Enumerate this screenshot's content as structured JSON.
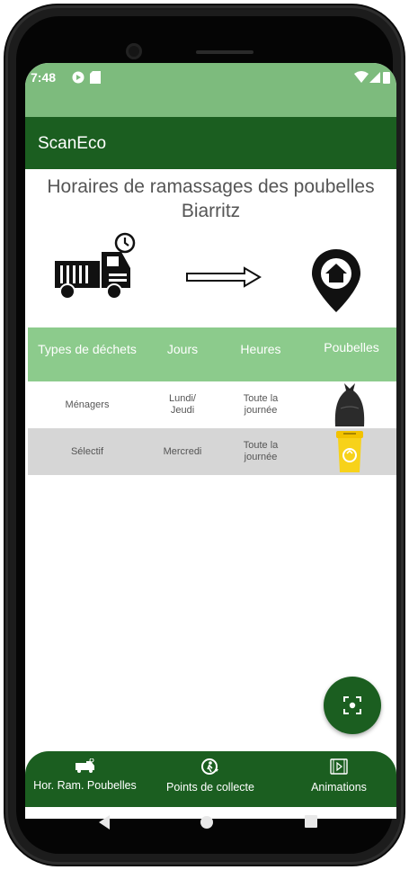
{
  "status_bar": {
    "time": "7:48"
  },
  "app_bar": {
    "title": "ScanEco"
  },
  "page": {
    "heading_line1": "Horaires de ramassages des poubelles",
    "heading_line2": "Biarritz"
  },
  "table": {
    "headers": [
      "Types de déchets",
      "Jours",
      "Heures",
      "Poubelles"
    ],
    "rows": [
      {
        "type": "Ménagers",
        "days_line1": "Lundi/",
        "days_line2": "Jeudi",
        "hours_line1": "Toute la",
        "hours_line2": "journée",
        "bin_icon": "black-trash-bag-icon"
      },
      {
        "type": "Sélectif",
        "days_line1": "Mercredi",
        "days_line2": "",
        "hours_line1": "Toute la",
        "hours_line2": "journée",
        "bin_icon": "yellow-recycling-bin-icon"
      }
    ]
  },
  "bottom_nav": {
    "items": [
      {
        "label": "Hor. Ram. Poubelles",
        "icon": "garbage-truck-icon"
      },
      {
        "label": "Points de collecte",
        "icon": "recycle-person-icon"
      },
      {
        "label": "Animations",
        "icon": "play-video-icon"
      }
    ]
  },
  "colors": {
    "primary": "#1b5e20",
    "status_bar": "#7dbb7d",
    "table_header": "#8ccb8c",
    "alt_row": "#d6d6d6"
  }
}
